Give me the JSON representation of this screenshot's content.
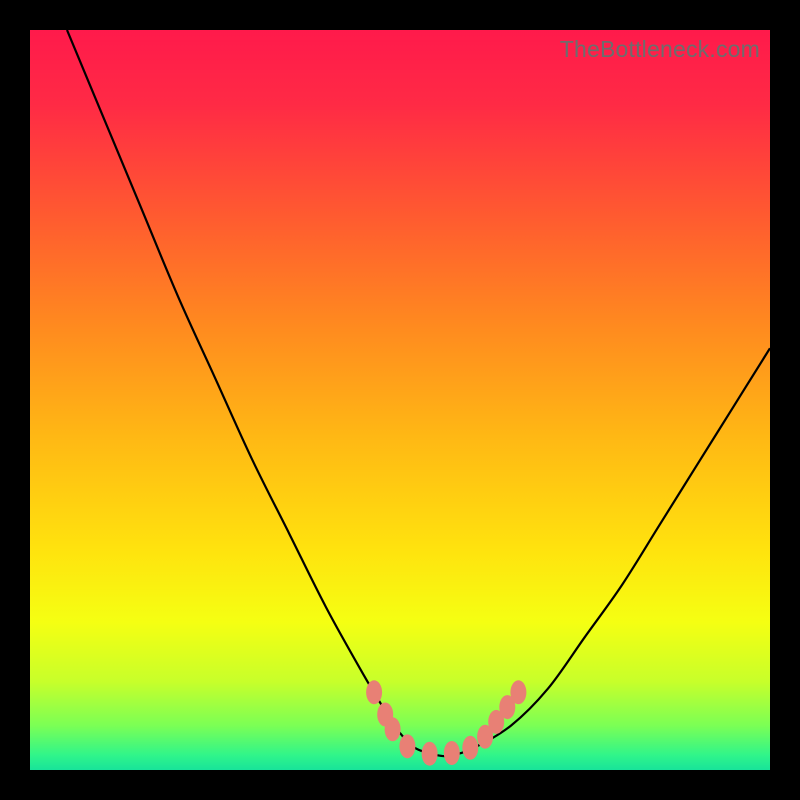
{
  "watermark": "TheBottleneck.com",
  "chart_data": {
    "type": "line",
    "title": "",
    "xlabel": "",
    "ylabel": "",
    "xlim": [
      0,
      100
    ],
    "ylim": [
      0,
      100
    ],
    "x": [
      5,
      10,
      15,
      20,
      25,
      30,
      35,
      40,
      45,
      48,
      50,
      52,
      55,
      57,
      60,
      65,
      70,
      75,
      80,
      85,
      90,
      95,
      100
    ],
    "values": [
      100,
      88,
      76,
      64,
      53,
      42,
      32,
      22,
      13,
      8,
      5,
      3,
      2,
      2,
      3,
      6,
      11,
      18,
      25,
      33,
      41,
      49,
      57
    ],
    "gradient_stops": [
      {
        "offset": 0.0,
        "color": "#ff1a4b"
      },
      {
        "offset": 0.1,
        "color": "#ff2a45"
      },
      {
        "offset": 0.25,
        "color": "#ff5a30"
      },
      {
        "offset": 0.4,
        "color": "#ff8a1f"
      },
      {
        "offset": 0.55,
        "color": "#ffb814"
      },
      {
        "offset": 0.7,
        "color": "#ffe20e"
      },
      {
        "offset": 0.8,
        "color": "#f5ff12"
      },
      {
        "offset": 0.88,
        "color": "#c8ff2a"
      },
      {
        "offset": 0.94,
        "color": "#7bff55"
      },
      {
        "offset": 0.98,
        "color": "#30f58a"
      },
      {
        "offset": 1.0,
        "color": "#18e39a"
      }
    ],
    "markers": [
      {
        "x": 46.5,
        "y": 10.5
      },
      {
        "x": 48.0,
        "y": 7.5
      },
      {
        "x": 49.0,
        "y": 5.5
      },
      {
        "x": 51.0,
        "y": 3.2
      },
      {
        "x": 54.0,
        "y": 2.2
      },
      {
        "x": 57.0,
        "y": 2.3
      },
      {
        "x": 59.5,
        "y": 3.0
      },
      {
        "x": 61.5,
        "y": 4.5
      },
      {
        "x": 63.0,
        "y": 6.5
      },
      {
        "x": 64.5,
        "y": 8.5
      },
      {
        "x": 66.0,
        "y": 10.5
      }
    ],
    "marker_color": "#e88075"
  }
}
